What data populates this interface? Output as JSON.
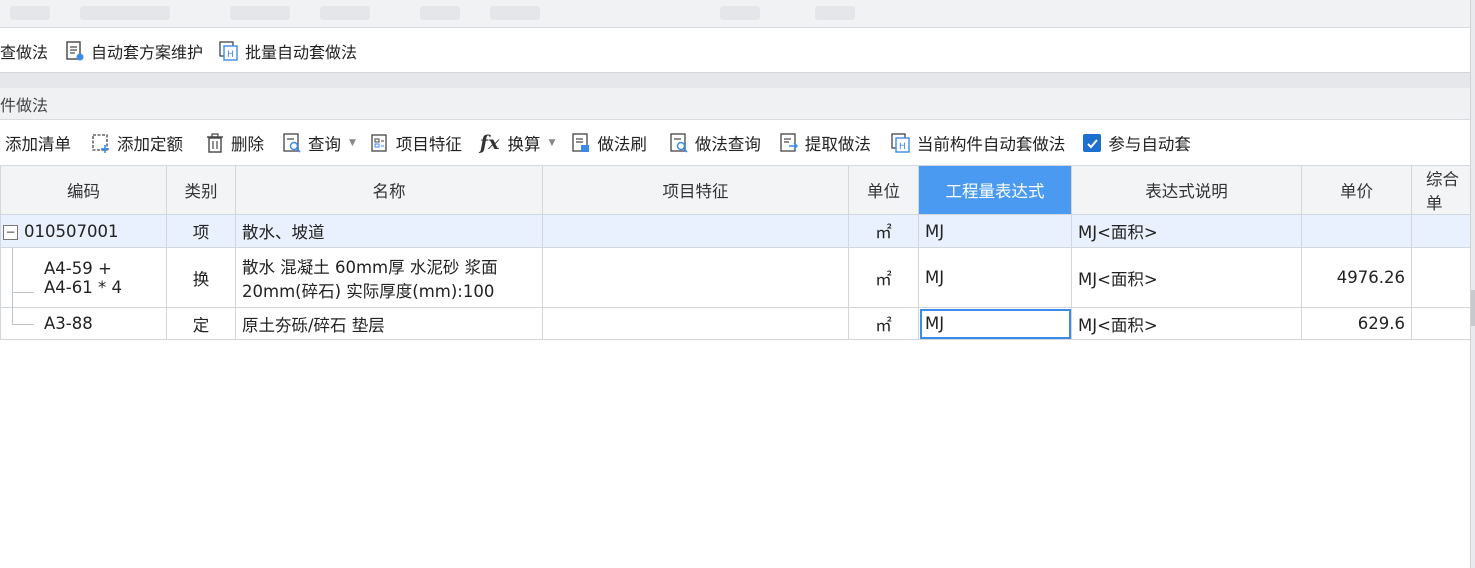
{
  "toolbar_top": {
    "items": [
      {
        "label": "查做法",
        "icon": "none"
      },
      {
        "label": "自动套方案维护",
        "icon": "document-settings-icon"
      },
      {
        "label": "批量自动套做法",
        "icon": "batch-apply-icon"
      }
    ]
  },
  "panel": {
    "title": "件做法"
  },
  "toolbar_main": {
    "items": [
      {
        "label": "添加清单",
        "icon": "none"
      },
      {
        "label": "添加定额",
        "icon": "add-quota-icon"
      },
      {
        "label": "删除",
        "icon": "trash-icon"
      },
      {
        "label": "查询",
        "icon": "query-icon",
        "dropdown": true
      },
      {
        "label": "项目特征",
        "icon": "feature-icon"
      },
      {
        "label": "换算",
        "icon": "fx-icon",
        "dropdown": true
      },
      {
        "label": "做法刷",
        "icon": "brush-icon"
      },
      {
        "label": "做法查询",
        "icon": "method-query-icon"
      },
      {
        "label": "提取做法",
        "icon": "extract-icon"
      },
      {
        "label": "当前构件自动套做法",
        "icon": "auto-apply-icon"
      }
    ],
    "checkbox": {
      "label": "参与自动套",
      "checked": true
    }
  },
  "table": {
    "columns": [
      "编码",
      "类别",
      "名称",
      "项目特征",
      "单位",
      "工程量表达式",
      "表达式说明",
      "单价",
      "综合单"
    ],
    "active_column": "工程量表达式",
    "rows": [
      {
        "expander": "−",
        "code_lines": [
          "010507001"
        ],
        "category": "项",
        "name_lines": [
          "散水、坡道"
        ],
        "feature": "",
        "unit": "㎡",
        "expr": "MJ",
        "expr_desc": "MJ<面积>",
        "price": "",
        "total": ""
      },
      {
        "code_lines": [
          "A4-59 +",
          "A4-61 * 4"
        ],
        "category": "换",
        "name_lines": [
          "散水 混凝土 60mm厚 水泥砂 浆面",
          "20mm(碎石)  实际厚度(mm):100"
        ],
        "feature": "",
        "unit": "㎡",
        "expr": "MJ",
        "expr_desc": "MJ<面积>",
        "price": "4976.26",
        "total": ""
      },
      {
        "code_lines": [
          "A3-88"
        ],
        "category": "定",
        "name_lines": [
          "原土夯砾/碎石 垫层"
        ],
        "feature": "",
        "unit": "㎡",
        "expr": "MJ",
        "expr_desc": "MJ<面积>",
        "price": "629.6",
        "total": ""
      }
    ]
  },
  "colors": {
    "accent": "#4a9af2",
    "selected_row": "#e8f1fd",
    "checkbox": "#1f6fd1"
  }
}
